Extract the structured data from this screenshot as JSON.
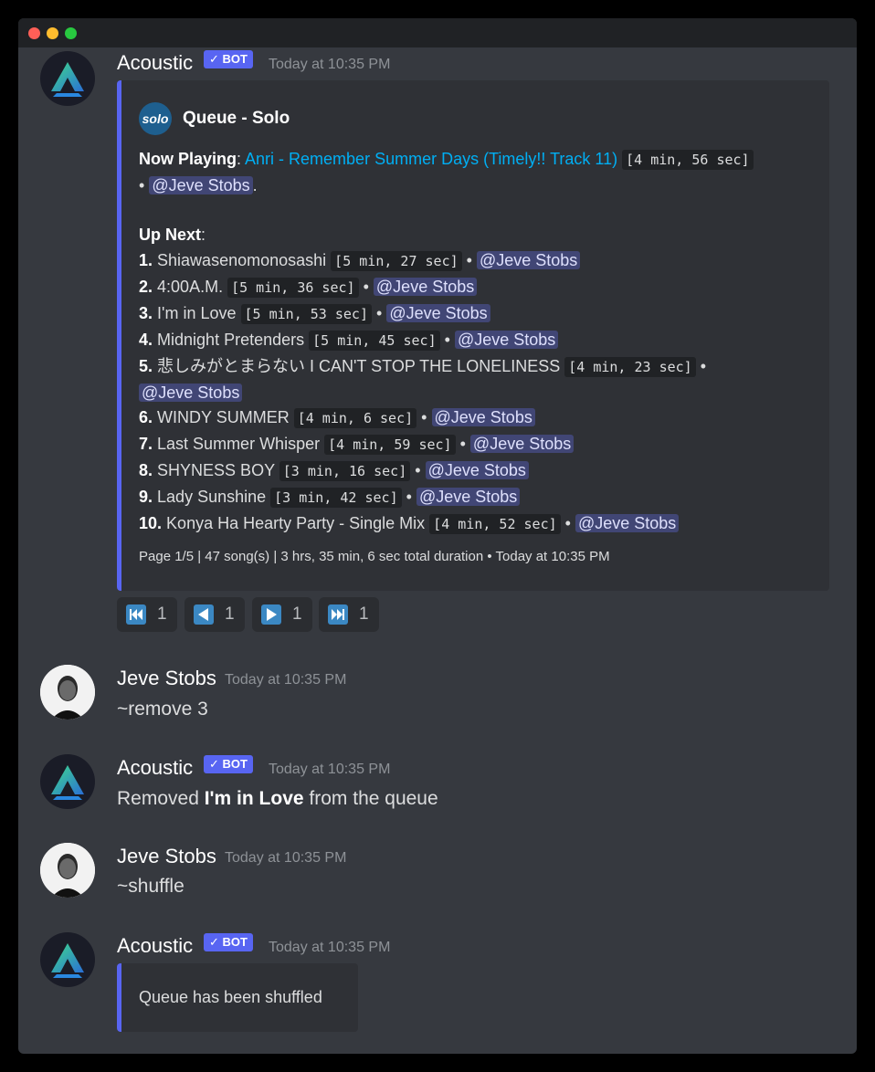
{
  "messages": {
    "m1": {
      "username": "Acoustic",
      "bot_tag": "✓ BOT",
      "timestamp": "Today at 10:35 PM",
      "embed": {
        "author": "Queue - Solo",
        "author_icon_text": "solo",
        "now_playing_label": "Now Playing",
        "now_playing_title": "Anri - Remember Summer Days (Timely!! Track 11)",
        "now_playing_duration": "[4 min, 56 sec]",
        "now_playing_mention": "@Jeve Stobs",
        "up_next_label": "Up Next",
        "tracks": [
          {
            "num": "1.",
            "title": "Shiawasenomonosashi",
            "duration": "[5 min, 27 sec]",
            "mention": "@Jeve Stobs"
          },
          {
            "num": "2.",
            "title": "4:00A.M.",
            "duration": "[5 min, 36 sec]",
            "mention": "@Jeve Stobs"
          },
          {
            "num": "3.",
            "title": "I'm in Love",
            "duration": "[5 min, 53 sec]",
            "mention": "@Jeve Stobs"
          },
          {
            "num": "4.",
            "title": "Midnight Pretenders",
            "duration": "[5 min, 45 sec]",
            "mention": "@Jeve Stobs"
          },
          {
            "num": "5.",
            "title": "悲しみがとまらない I CAN'T STOP THE LONELINESS",
            "duration": "[4 min, 23 sec]",
            "mention": "@Jeve Stobs"
          },
          {
            "num": "6.",
            "title": "WINDY SUMMER",
            "duration": "[4 min, 6 sec]",
            "mention": "@Jeve Stobs"
          },
          {
            "num": "7.",
            "title": "Last Summer Whisper",
            "duration": "[4 min, 59 sec]",
            "mention": "@Jeve Stobs"
          },
          {
            "num": "8.",
            "title": "SHYNESS BOY",
            "duration": "[3 min, 16 sec]",
            "mention": "@Jeve Stobs"
          },
          {
            "num": "9.",
            "title": "Lady Sunshine",
            "duration": "[3 min, 42 sec]",
            "mention": "@Jeve Stobs"
          },
          {
            "num": "10.",
            "title": "Konya Ha Hearty Party - Single Mix",
            "duration": "[4 min, 52 sec]",
            "mention": "@Jeve Stobs"
          }
        ],
        "footer": "Page 1/5 | 47 song(s) | 3 hrs, 35 min, 6 sec total duration",
        "footer_timestamp": "Today at 10:35 PM"
      },
      "buttons": [
        {
          "icon": "first-page-icon",
          "count": "1"
        },
        {
          "icon": "previous-page-icon",
          "count": "1"
        },
        {
          "icon": "next-page-icon",
          "count": "1"
        },
        {
          "icon": "last-page-icon",
          "count": "1"
        }
      ]
    },
    "m2": {
      "username": "Jeve Stobs",
      "timestamp": "Today at 10:35 PM",
      "text": "~remove 3"
    },
    "m3": {
      "username": "Acoustic",
      "bot_tag": "✓ BOT",
      "timestamp": "Today at 10:35 PM",
      "text_pre": "Removed ",
      "text_bold": "I'm in Love",
      "text_post": " from the queue"
    },
    "m4": {
      "username": "Jeve Stobs",
      "timestamp": "Today at 10:35 PM",
      "text": "~shuffle"
    },
    "m5": {
      "username": "Acoustic",
      "bot_tag": "✓ BOT",
      "timestamp": "Today at 10:35 PM",
      "embed_text": "Queue has been shuffled"
    }
  },
  "colors": {
    "background": "#36393f",
    "titlebar": "#202225",
    "embed": "#2f3136",
    "accent": "#5865f2",
    "link": "#00aff4",
    "mention_bg": "#414675"
  }
}
